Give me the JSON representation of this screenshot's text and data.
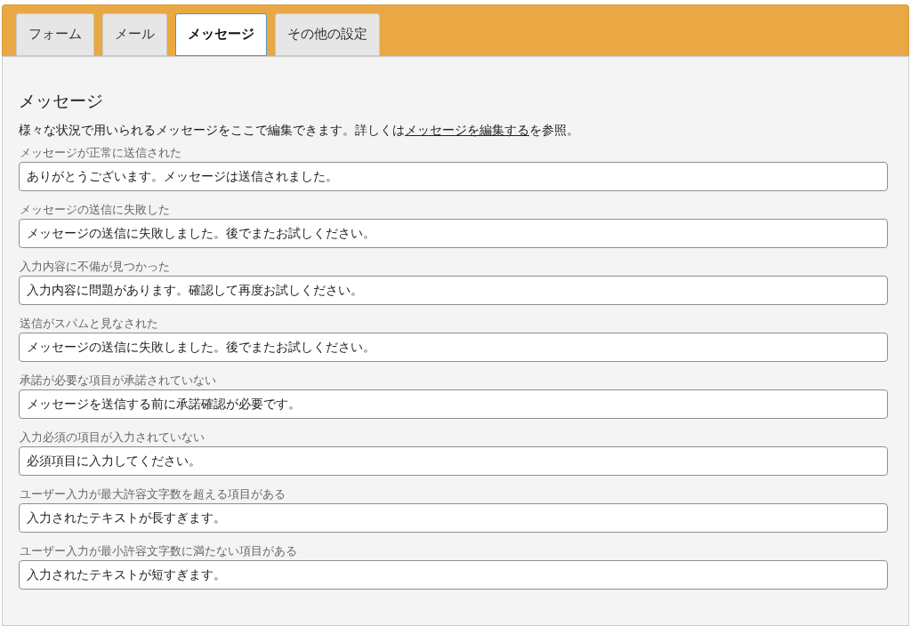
{
  "tabs": [
    {
      "label": "フォーム",
      "selected": false
    },
    {
      "label": "メール",
      "selected": false
    },
    {
      "label": "メッセージ",
      "selected": true
    },
    {
      "label": "その他の設定",
      "selected": false
    }
  ],
  "section": {
    "title": "メッセージ",
    "description_before": "様々な状況で用いられるメッセージをここで編集できます。詳しくは",
    "description_link": "メッセージを編集する",
    "description_after": "を参照。"
  },
  "fields": [
    {
      "label": "メッセージが正常に送信された",
      "value": "ありがとうございます。メッセージは送信されました。"
    },
    {
      "label": "メッセージの送信に失敗した",
      "value": "メッセージの送信に失敗しました。後でまたお試しください。"
    },
    {
      "label": "入力内容に不備が見つかった",
      "value": "入力内容に問題があります。確認して再度お試しください。"
    },
    {
      "label": "送信がスパムと見なされた",
      "value": "メッセージの送信に失敗しました。後でまたお試しください。"
    },
    {
      "label": "承諾が必要な項目が承諾されていない",
      "value": "メッセージを送信する前に承諾確認が必要です。"
    },
    {
      "label": "入力必須の項目が入力されていない",
      "value": "必須項目に入力してください。"
    },
    {
      "label": "ユーザー入力が最大許容文字数を超える項目がある",
      "value": "入力されたテキストが長すぎます。"
    },
    {
      "label": "ユーザー入力が最小許容文字数に満たない項目がある",
      "value": "入力されたテキストが短すぎます。"
    }
  ]
}
